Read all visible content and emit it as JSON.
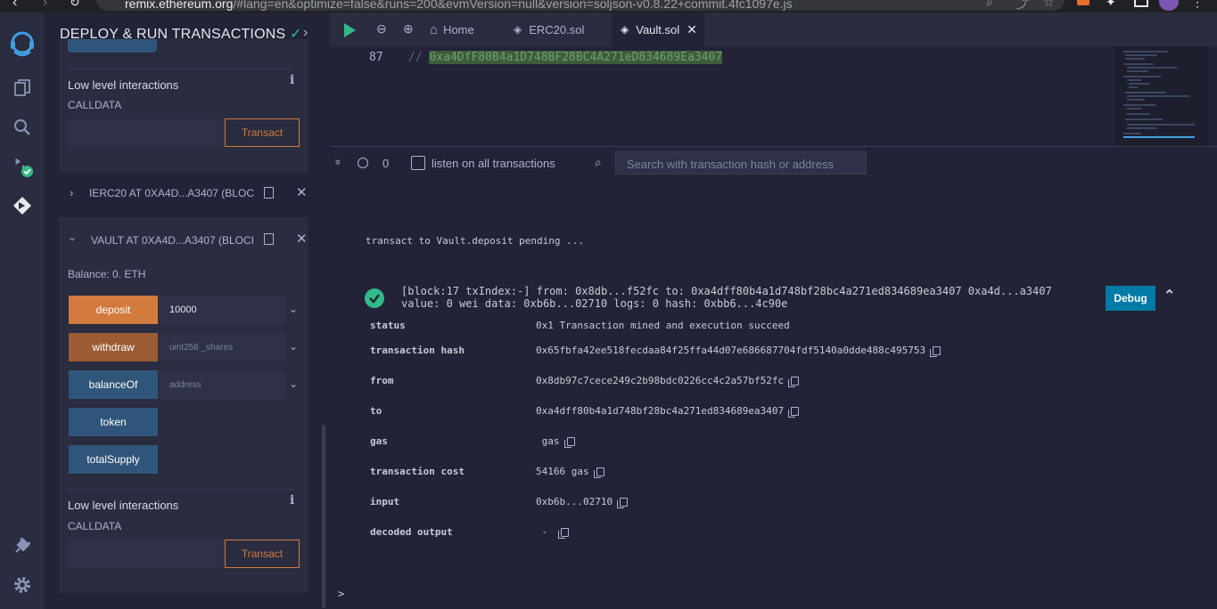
{
  "browser": {
    "url_host": "remix.ethereum.org",
    "url_rest": "/#lang=en&optimize=false&runs=200&evmVersion=null&version=soljson-v0.8.22+commit.4fc1097e.js"
  },
  "panel": {
    "title": "DEPLOY & RUN TRANSACTIONS",
    "low_level_1": {
      "heading": "Low level interactions",
      "calldata_label": "CALLDATA",
      "transact_label": "Transact"
    },
    "contract_1": {
      "name": "IERC20 AT 0XA4D...A3407 (BLOC"
    },
    "contract_2": {
      "name": "VAULT AT 0XA4D...A3407 (BLOCI",
      "balance": "Balance: 0. ETH",
      "functions": [
        {
          "label": "deposit",
          "input": "10000",
          "placeholder": "",
          "has_input": true
        },
        {
          "label": "withdraw",
          "input": "",
          "placeholder": "uint256 _shares",
          "has_input": true
        },
        {
          "label": "balanceOf",
          "input": "",
          "placeholder": "address",
          "has_input": true
        },
        {
          "label": "token"
        },
        {
          "label": "totalSupply"
        }
      ]
    },
    "low_level_2": {
      "heading": "Low level interactions",
      "calldata_label": "CALLDATA",
      "transact_label": "Transact"
    }
  },
  "tabs": [
    {
      "label": "Home",
      "icon": "home-icon"
    },
    {
      "label": "ERC20.sol",
      "icon": "solidity-icon"
    },
    {
      "label": "Vault.sol",
      "icon": "solidity-icon",
      "active": true
    }
  ],
  "editor": {
    "line_number": "87",
    "comment_prefix": "//",
    "highlighted": "0xa4DfF80B4a1D748BF28BC4A271eD834689Ea3407"
  },
  "terminal": {
    "count": "0",
    "listen_label": "listen on all transactions",
    "search_placeholder": "Search with transaction hash or address",
    "pending_text": "transact to Vault.deposit pending ...",
    "tx_header_line1": "[block:17 txIndex:-] from: 0x8db...f52fc to: 0xa4dff80b4a1d748bf28bc4a271ed834689ea3407 0xa4d...a3407",
    "tx_header_line2": "value: 0 wei data: 0xb6b...02710 logs: 0 hash: 0xbb6...4c90e",
    "debug_label": "Debug",
    "details": [
      {
        "key": "status",
        "value": "0x1 Transaction mined and execution succeed",
        "copy": false
      },
      {
        "key": "transaction hash",
        "value": "0x65fbfa42ee518fecdaa84f25ffa44d07e686687704fdf5140a0dde488c495753",
        "copy": true
      },
      {
        "key": "from",
        "value": "0x8db97c7cece249c2b98bdc0226cc4c2a57bf52fc",
        "copy": true
      },
      {
        "key": "to",
        "value": "0xa4dff80b4a1d748bf28bc4a271ed834689ea3407",
        "copy": true
      },
      {
        "key": "gas",
        "value": " gas",
        "copy": true
      },
      {
        "key": "transaction cost",
        "value": "54166 gas",
        "copy": true
      },
      {
        "key": "input",
        "value": "0xb6b...02710",
        "copy": true
      },
      {
        "key": "decoded output",
        "value": " - ",
        "copy": true
      }
    ],
    "prompt": ">"
  },
  "colors": {
    "accent_green": "#32ba89",
    "orange": "#d37a3f",
    "debug_blue": "#007aa6"
  }
}
